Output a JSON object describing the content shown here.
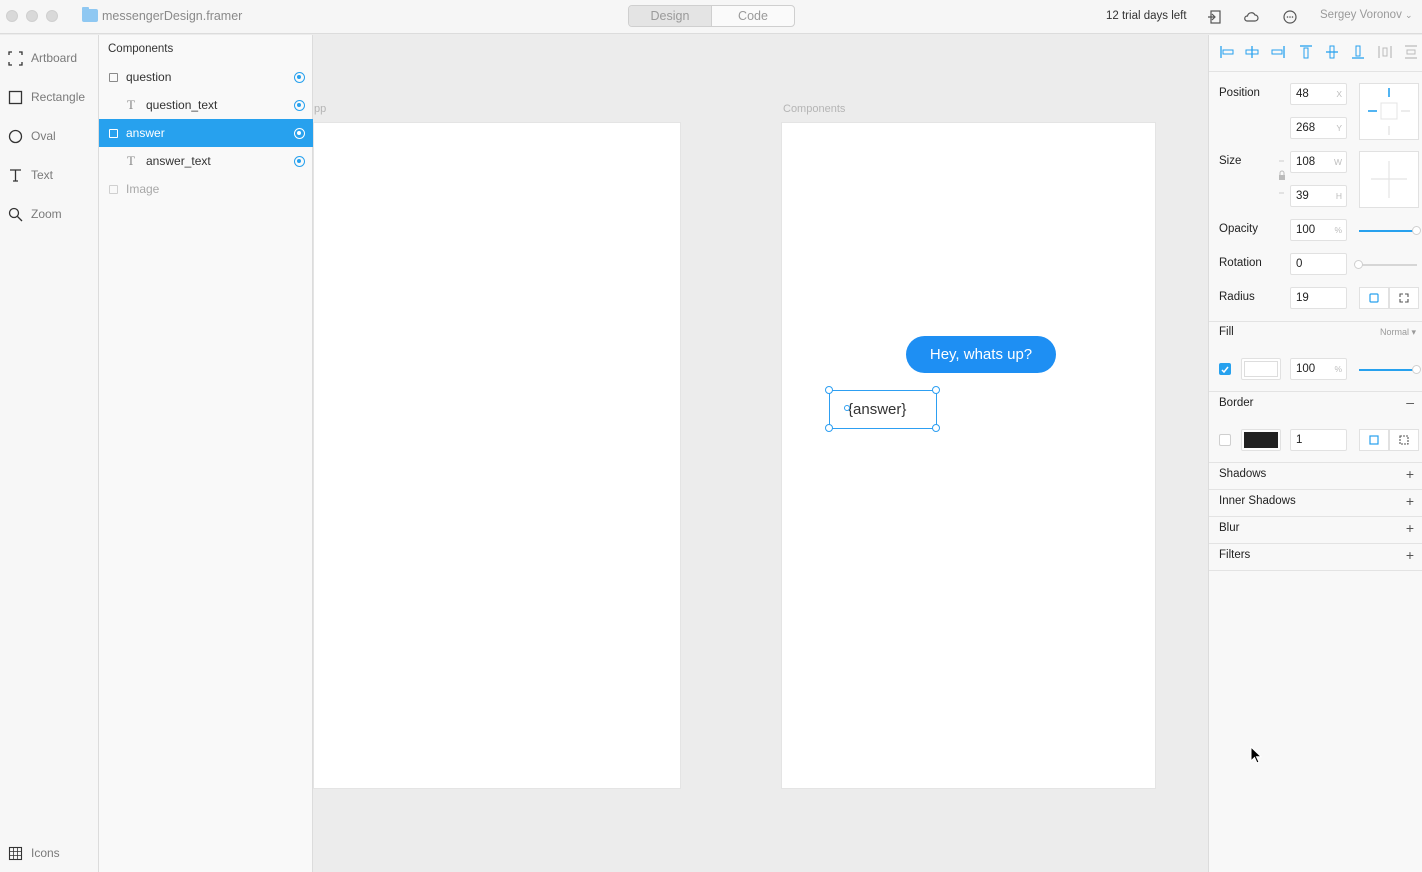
{
  "window": {
    "file_name": "messengerDesign.framer",
    "mode_tabs": [
      "Design",
      "Code"
    ],
    "active_mode": "Design",
    "trial": "12 trial days left",
    "user": "Sergey Voronov"
  },
  "tools": {
    "items": [
      {
        "label": "Artboard",
        "icon": "artboard-icon"
      },
      {
        "label": "Rectangle",
        "icon": "rectangle-icon"
      },
      {
        "label": "Oval",
        "icon": "oval-icon"
      },
      {
        "label": "Text",
        "icon": "text-icon"
      },
      {
        "label": "Zoom",
        "icon": "zoom-icon"
      }
    ],
    "bottom": {
      "label": "Icons",
      "icon": "grid-icon"
    }
  },
  "layers": {
    "title": "Components",
    "items": [
      {
        "label": "question",
        "type": "rect",
        "level": 0,
        "target": true
      },
      {
        "label": "question_text",
        "type": "text",
        "level": 1,
        "target": true
      },
      {
        "label": "answer",
        "type": "rect",
        "level": 0,
        "target": true,
        "selected": true
      },
      {
        "label": "answer_text",
        "type": "text",
        "level": 1,
        "target": true
      },
      {
        "label": "Image",
        "type": "rect",
        "level": 0,
        "target": false,
        "dim": true
      }
    ]
  },
  "canvas": {
    "artboard_app_label": "pp",
    "artboard_components_label": "Components",
    "bubble_text": "Hey, whats up?",
    "answer_text": "{answer}"
  },
  "inspector": {
    "position_label": "Position",
    "x": "48",
    "x_unit": "X",
    "y": "268",
    "y_unit": "Y",
    "size_label": "Size",
    "w": "108",
    "w_unit": "W",
    "h": "39",
    "h_unit": "H",
    "opacity_label": "Opacity",
    "opacity": "100",
    "opacity_unit": "%",
    "opacity_level": 1.0,
    "rotation_label": "Rotation",
    "rotation": "0",
    "rotation_level": 0.0,
    "radius_label": "Radius",
    "radius": "19",
    "fill_label": "Fill",
    "fill_blend": "Normal",
    "fill_opacity": "100",
    "fill_unit": "%",
    "fill_color": "#ffffff",
    "border_label": "Border",
    "border_width": "1",
    "border_color": "#222222",
    "shadows_label": "Shadows",
    "inner_shadows_label": "Inner Shadows",
    "blur_label": "Blur",
    "filters_label": "Filters"
  },
  "colors": {
    "accent": "#27a1ee",
    "bubble": "#1e8ff3"
  }
}
